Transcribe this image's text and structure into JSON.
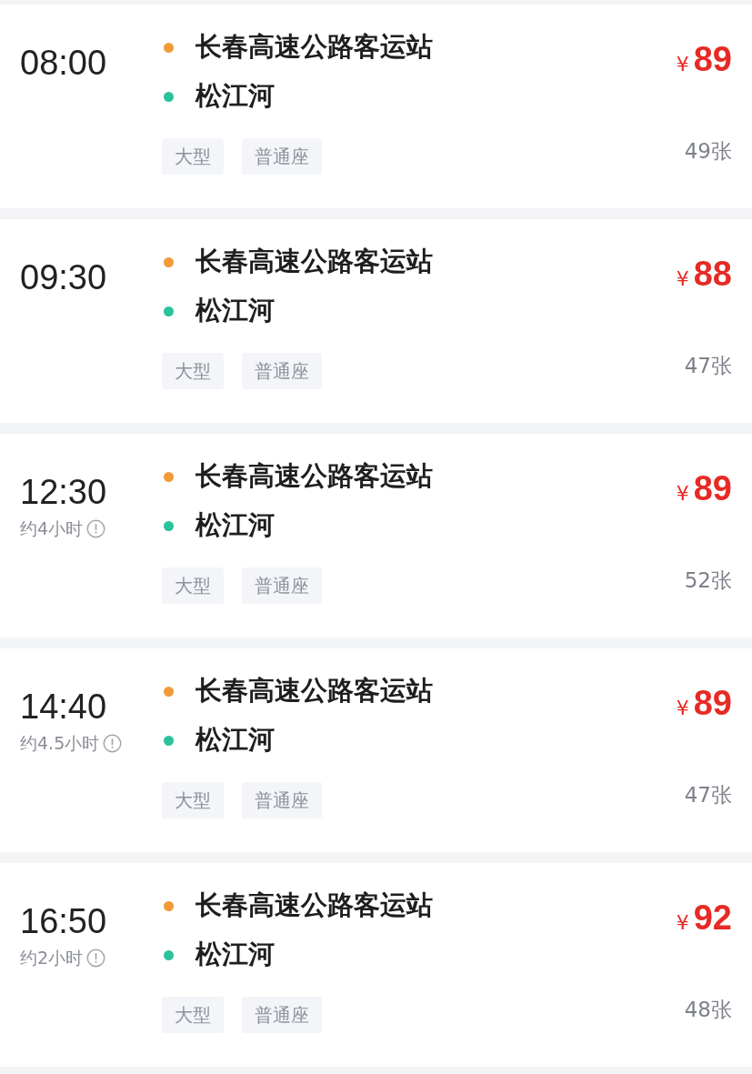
{
  "trips": [
    {
      "time": "08:00",
      "stations": [
        {
          "name": "长春高速公路客运站",
          "color": "#f29a38"
        },
        {
          "name": "松江河",
          "color": "#2bc29b"
        }
      ],
      "tags": [
        "大型",
        "普通座"
      ],
      "currency": "¥",
      "price": "89",
      "seats": "49张"
    },
    {
      "time": "09:30",
      "stations": [
        {
          "name": "长春高速公路客运站",
          "color": "#f29a38"
        },
        {
          "name": "松江河",
          "color": "#2bc29b"
        }
      ],
      "tags": [
        "大型",
        "普通座"
      ],
      "currency": "¥",
      "price": "88",
      "seats": "47张"
    },
    {
      "time": "12:30",
      "duration": "约4小时",
      "stations": [
        {
          "name": "长春高速公路客运站",
          "color": "#f29a38"
        },
        {
          "name": "松江河",
          "color": "#2bc29b"
        }
      ],
      "tags": [
        "大型",
        "普通座"
      ],
      "currency": "¥",
      "price": "89",
      "seats": "52张"
    },
    {
      "time": "14:40",
      "duration": "约4.5小时",
      "stations": [
        {
          "name": "长春高速公路客运站",
          "color": "#f29a38"
        },
        {
          "name": "松江河",
          "color": "#2bc29b"
        }
      ],
      "tags": [
        "大型",
        "普通座"
      ],
      "currency": "¥",
      "price": "89",
      "seats": "47张"
    },
    {
      "time": "16:50",
      "duration": "约2小时",
      "stations": [
        {
          "name": "长春高速公路客运站",
          "color": "#f29a38"
        },
        {
          "name": "松江河",
          "color": "#2bc29b"
        }
      ],
      "tags": [
        "大型",
        "普通座"
      ],
      "currency": "¥",
      "price": "92",
      "seats": "48张"
    }
  ]
}
